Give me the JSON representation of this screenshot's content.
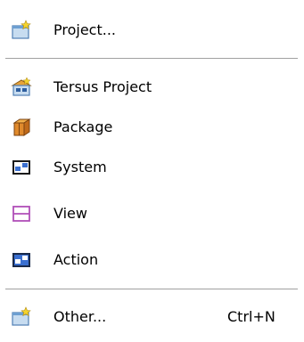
{
  "menu": {
    "items": [
      {
        "label": "Project...",
        "icon": "new-project-wizard-icon"
      },
      {
        "label": "Tersus Project",
        "icon": "tersus-project-icon"
      },
      {
        "label": "Package",
        "icon": "package-icon"
      },
      {
        "label": "System",
        "icon": "system-icon"
      },
      {
        "label": "View",
        "icon": "view-icon"
      },
      {
        "label": "Action",
        "icon": "action-icon"
      },
      {
        "label": "Other...",
        "icon": "new-wizard-icon",
        "shortcut": "Ctrl+N"
      }
    ]
  },
  "colors": {
    "folder_blue": "#6d9fd1",
    "folder_light": "#c7dcf0",
    "star_yellow": "#f4d32d",
    "package_orange": "#d9862a",
    "view_purple": "#b04fb8",
    "system_dark": "#1a1a1a",
    "system_blue": "#3a6fd0"
  }
}
